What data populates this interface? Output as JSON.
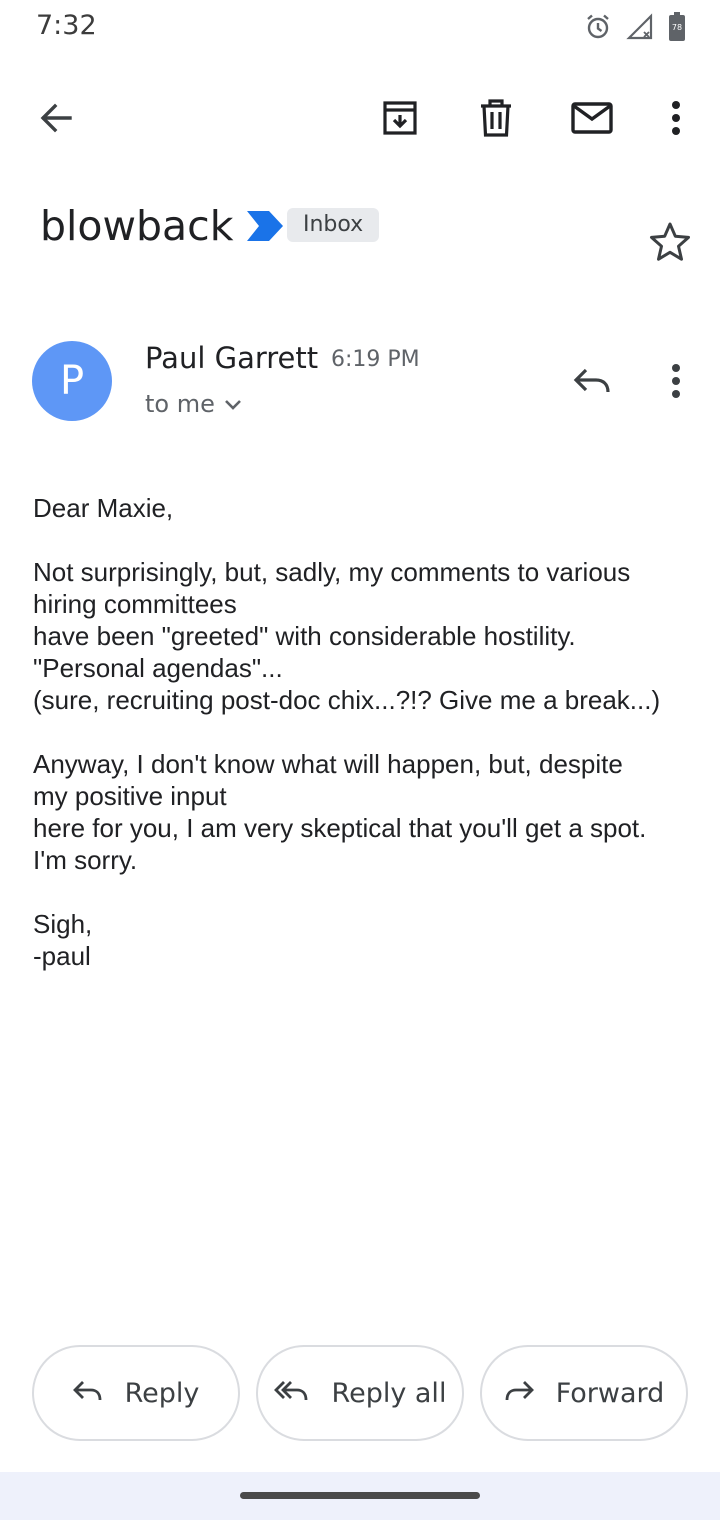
{
  "status_bar": {
    "time": "7:32",
    "icons": [
      "alarm-icon",
      "signal-off-icon",
      "battery-icon"
    ],
    "battery_level": "78"
  },
  "toolbar": {
    "icons": [
      "back-arrow-icon",
      "archive-icon",
      "delete-icon",
      "mark-unread-icon",
      "more-vert-icon"
    ]
  },
  "email": {
    "subject": "blowback",
    "label": "Inbox",
    "sender_initial": "P",
    "sender_name": "Paul Garrett",
    "time": "6:19 PM",
    "recipients": "to me",
    "body": [
      "Dear Maxie,",
      "Not surprisingly, but, sadly, my comments to various\nhiring committees\nhave been \"greeted\" with considerable hostility.\n\"Personal agendas\"...\n(sure, recruiting post-doc chix...?!? Give me a break...)",
      "Anyway, I don't know what will happen, but, despite\nmy positive input\nhere for you, I am very skeptical that you'll get a spot.\nI'm sorry.",
      "Sigh,\n-paul"
    ]
  },
  "actions": {
    "reply": "Reply",
    "reply_all": "Reply all",
    "forward": "Forward"
  },
  "colors": {
    "avatar": "#5e97f6",
    "importance_marker": "#1a73e8",
    "label_chip": "#e8eaed",
    "nav_bar": "#eef1fb"
  }
}
